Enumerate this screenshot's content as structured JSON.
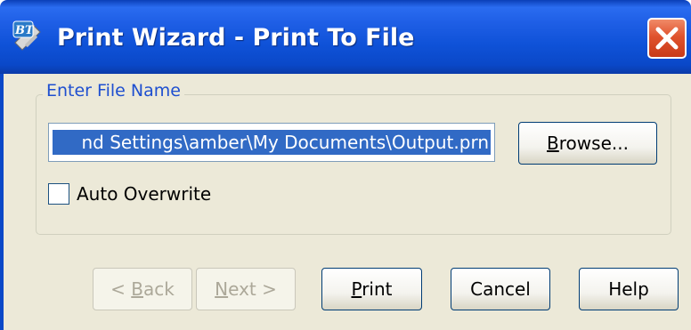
{
  "window": {
    "title": "Print Wizard - Print To File",
    "icon": "bt-app-icon",
    "close_icon": "close-icon"
  },
  "file_group": {
    "title": "Enter File Name",
    "filename_value": "nd Settings\\amber\\My Documents\\Output.prn",
    "browse": {
      "mnemonic": "B",
      "rest": "rowse..."
    },
    "auto_overwrite": {
      "label": "Auto Overwrite",
      "checked": false
    }
  },
  "buttons": {
    "back": {
      "prefix": "< ",
      "mnemonic": "B",
      "rest": "ack",
      "enabled": false
    },
    "next": {
      "mnemonic": "N",
      "rest": "ext >",
      "enabled": false
    },
    "print": {
      "mnemonic": "P",
      "rest": "rint",
      "enabled": true
    },
    "cancel": {
      "label": "Cancel",
      "enabled": true
    },
    "help": {
      "label": "Help",
      "enabled": true
    }
  },
  "colors": {
    "title_bar": "#0a48c8",
    "dialog_bg": "#ece9d8",
    "group_title": "#1e4fd0",
    "selection": "#316ac5",
    "close_button": "#e0532e"
  }
}
